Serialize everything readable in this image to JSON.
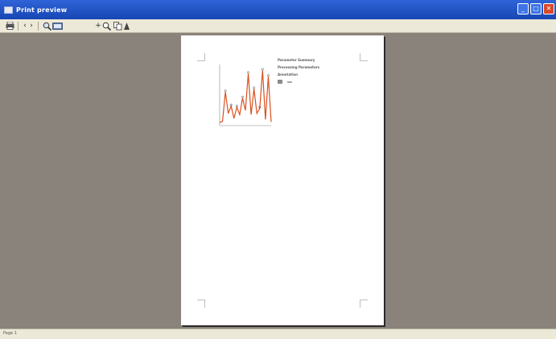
{
  "window": {
    "title": "Print preview",
    "buttons": {
      "minimize": "_",
      "maximize": "□",
      "close": "✕"
    }
  },
  "toolbar": {
    "items": [
      {
        "name": "print-button",
        "icon": "printer-icon"
      },
      {
        "name": "page-back-button",
        "label": "‹"
      },
      {
        "name": "page-forward-button",
        "label": "›"
      },
      {
        "name": "zoom-button",
        "icon": "magnifier-icon"
      },
      {
        "name": "view-mode-button",
        "icon": "page-view-icon"
      },
      {
        "name": "zoom-in-button",
        "label": "+"
      },
      {
        "name": "zoom-tool-button",
        "icon": "magnifier-icon"
      },
      {
        "name": "copy-button",
        "icon": "copy-icon"
      },
      {
        "name": "export-button",
        "icon": "export-icon"
      }
    ]
  },
  "document": {
    "heading1": "Parameter Summary",
    "heading2": "Processing Parameters",
    "heading3": "Annotation",
    "param_lines": [
      "",
      "",
      "",
      ""
    ],
    "proc_lines": [
      "",
      "",
      "",
      "",
      "",
      "",
      "",
      ""
    ],
    "annot_lines": [
      "",
      ""
    ],
    "action_label": "",
    "action_button": ""
  },
  "chart_data": {
    "type": "line",
    "title": "",
    "xlabel": "",
    "ylabel": "",
    "series": [
      {
        "values": [
          0.05,
          0.07,
          0.55,
          0.2,
          0.32,
          0.12,
          0.3,
          0.18,
          0.45,
          0.25,
          0.85,
          0.18,
          0.6,
          0.2,
          0.28,
          0.9,
          0.1,
          0.8,
          0.06
        ]
      }
    ],
    "colors": {
      "line": "#d9501f",
      "labels": "#4a4a4a"
    }
  },
  "table_rows": [
    [
      "",
      "",
      "",
      ""
    ],
    [
      "",
      "",
      "",
      ""
    ],
    [
      "",
      "",
      "",
      ""
    ],
    [
      "",
      "",
      "",
      ""
    ],
    [
      "",
      "",
      "",
      ""
    ],
    [
      "",
      "",
      "",
      ""
    ],
    [
      "",
      "",
      "",
      ""
    ],
    [
      "",
      "",
      "",
      ""
    ],
    [
      "",
      "",
      "",
      ""
    ],
    [
      "",
      "",
      "",
      ""
    ],
    [
      "",
      "",
      "",
      ""
    ]
  ],
  "status": {
    "text": "Page 1"
  }
}
